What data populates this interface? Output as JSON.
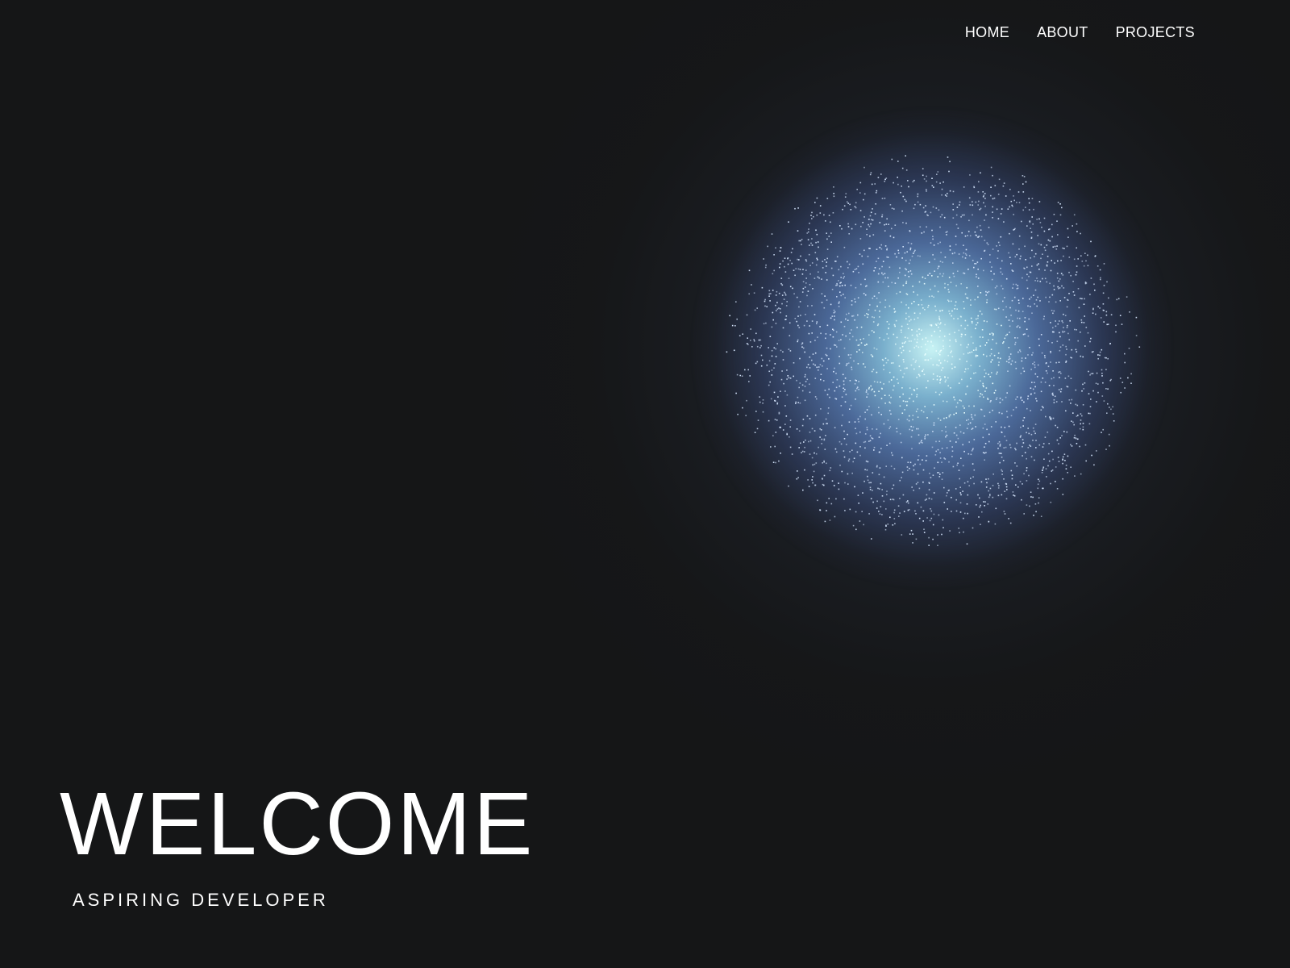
{
  "nav": {
    "items": [
      {
        "label": "HOME"
      },
      {
        "label": "ABOUT"
      },
      {
        "label": "PROJECTS"
      }
    ]
  },
  "hero": {
    "title": "WELCOME",
    "subtitle": "ASPIRING DEVELOPER"
  },
  "colors": {
    "background": "#151617",
    "text": "#ffffff",
    "particle": "#e6f4ff",
    "glow_core": "#d2ffff",
    "glow_outer": "#6ea0f0"
  }
}
